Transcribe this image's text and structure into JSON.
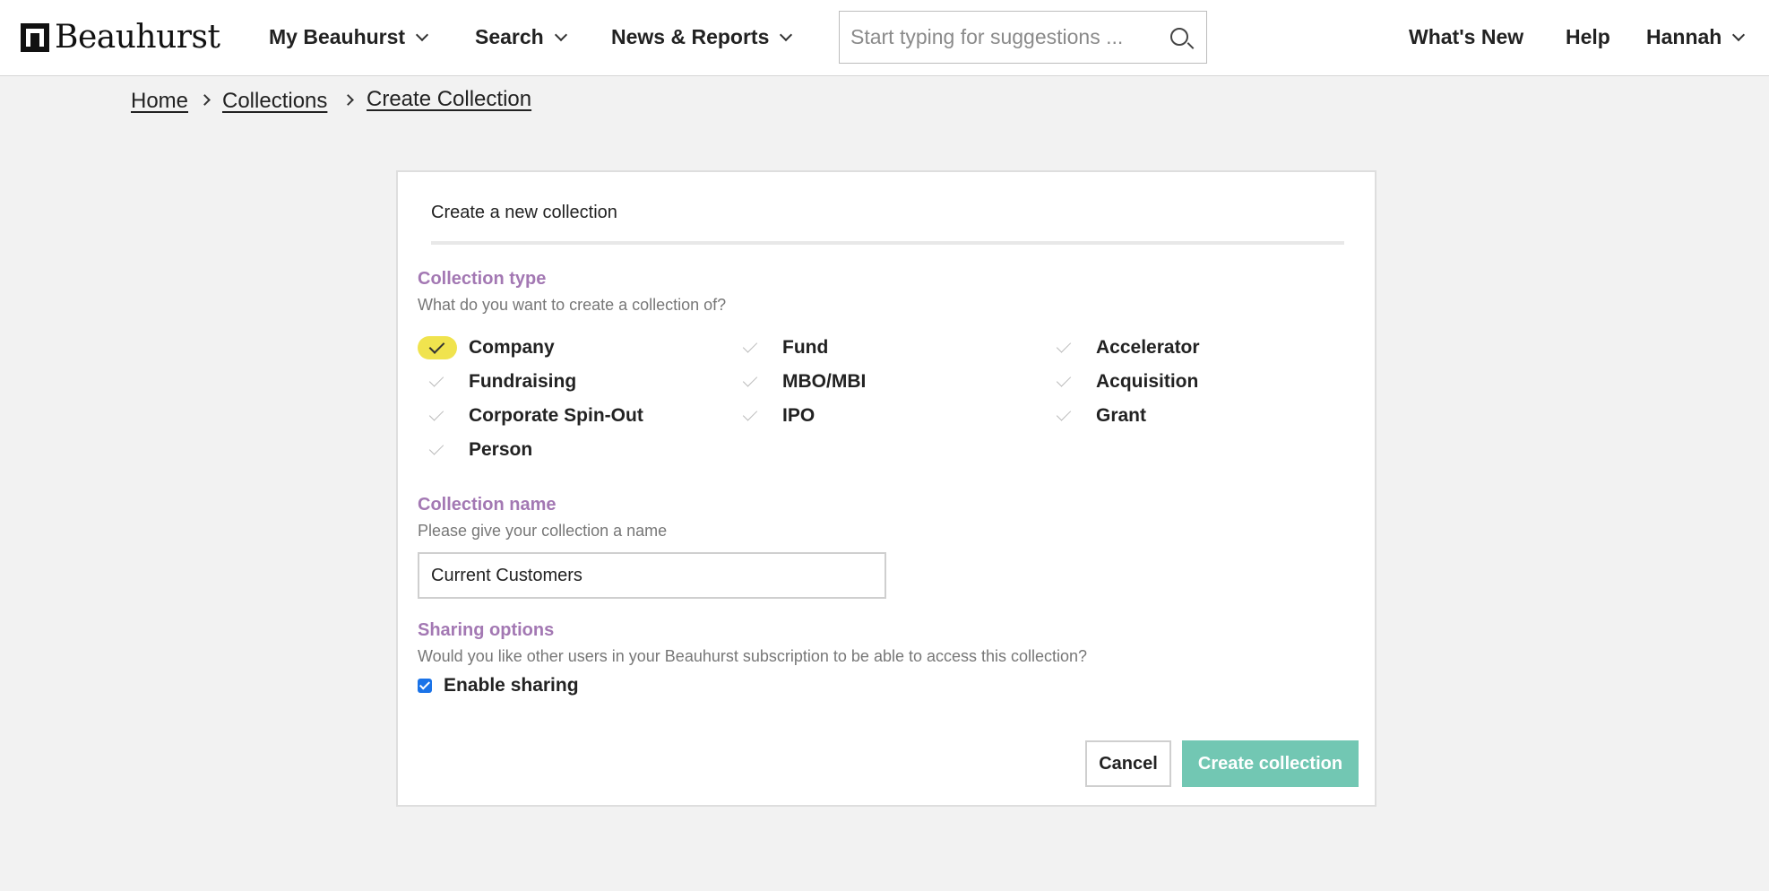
{
  "header": {
    "brand": "Beauhurst",
    "nav": [
      {
        "label": "My Beauhurst"
      },
      {
        "label": "Search"
      },
      {
        "label": "News & Reports"
      }
    ],
    "search_placeholder": "Start typing for suggestions ...",
    "right_links": [
      "What's New",
      "Help"
    ],
    "user_menu": "Hannah"
  },
  "breadcrumb": [
    "Home",
    "Collections",
    "Create Collection"
  ],
  "form": {
    "title": "Create a new collection",
    "collection_type": {
      "title": "Collection type",
      "help": "What do you want to create a collection of?",
      "selected": "Company",
      "options": [
        "Company",
        "Fund",
        "Accelerator",
        "Fundraising",
        "MBO/MBI",
        "Acquisition",
        "Corporate Spin-Out",
        "IPO",
        "Grant",
        "Person"
      ]
    },
    "collection_name": {
      "title": "Collection name",
      "help": "Please give your collection a name",
      "value": "Current Customers"
    },
    "sharing": {
      "title": "Sharing options",
      "help": "Would you like other users in your Beauhurst subscription to be able to access this collection?",
      "checkbox_label": "Enable sharing",
      "checked": true
    },
    "buttons": {
      "cancel": "Cancel",
      "create": "Create collection"
    }
  },
  "colors": {
    "section_title": "#a378b3",
    "selected_highlight": "#f0e34e",
    "create_button": "#72c7b3",
    "checkbox": "#1a73e8"
  }
}
